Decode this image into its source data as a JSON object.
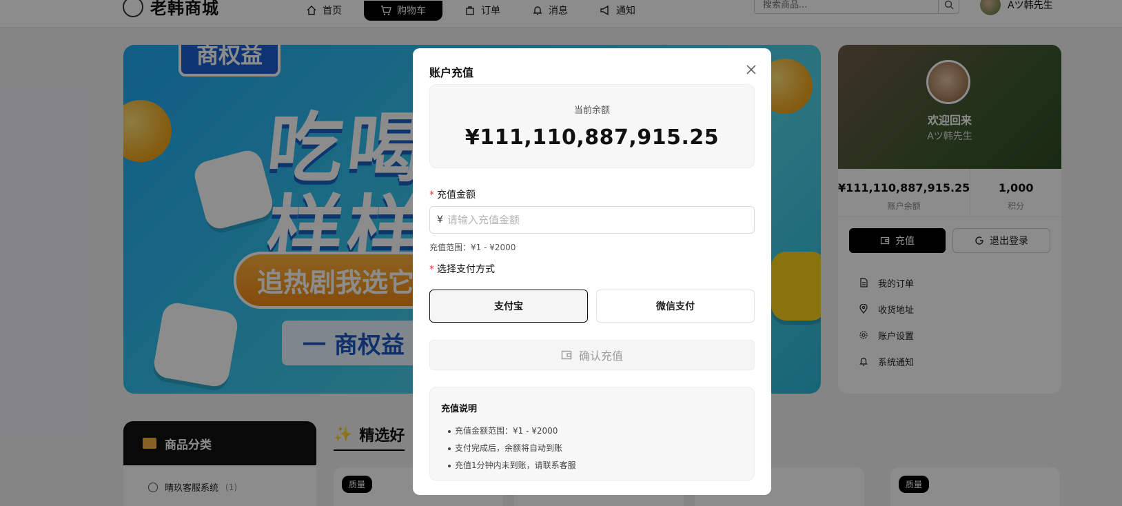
{
  "header": {
    "logo_text": "老韩商城",
    "nav": [
      {
        "label": "首页",
        "icon": "home-icon"
      },
      {
        "label": "购物车",
        "icon": "cart-icon"
      },
      {
        "label": "订单",
        "icon": "bag-icon"
      },
      {
        "label": "消息",
        "icon": "bell-icon"
      },
      {
        "label": "通知",
        "icon": "megaphone-icon"
      }
    ],
    "active_nav": "购物车",
    "search_placeholder": "搜索商品...",
    "username": "Aツ韩先生"
  },
  "banner": {
    "top_tag": "商权益",
    "line1": "吃喝",
    "line2": "样样",
    "pill": "追热剧我选它",
    "bar": "一 商权益"
  },
  "profile": {
    "welcome": "欢迎回来",
    "name": "Aツ韩先生",
    "balance_value": "¥111,110,887,915.25",
    "balance_label": "账户余额",
    "points_value": "1,000",
    "points_label": "积分",
    "recharge_btn": "充值",
    "logout_btn": "退出登录",
    "menu": [
      {
        "label": "我的订单",
        "icon": "document-icon"
      },
      {
        "label": "收货地址",
        "icon": "location-pin-icon"
      },
      {
        "label": "账户设置",
        "icon": "gear-icon"
      },
      {
        "label": "系统通知",
        "icon": "bell-icon"
      }
    ]
  },
  "categories": {
    "title": "商品分类",
    "items": [
      {
        "label": "晴玖客服系统",
        "count": "(1)"
      }
    ]
  },
  "featured": {
    "title": "精选好",
    "badge": "质量"
  },
  "modal": {
    "title": "账户充值",
    "balance_label": "当前余额",
    "balance_value": "¥111,110,887,915.25",
    "amount_label": "充值金额",
    "currency_symbol": "¥",
    "amount_placeholder": "请输入充值金额",
    "amount_value": "",
    "range_text": "充值范围：¥1 - ¥2000",
    "payment_label": "选择支付方式",
    "payment_options": [
      "支付宝",
      "微信支付"
    ],
    "selected_payment": "支付宝",
    "confirm_label": "确认充值",
    "notes_title": "充值说明",
    "notes": [
      "充值金额范围：¥1 - ¥2000",
      "支付完成后，余额将自动到账",
      "充值1分钟内未到账，请联系客服"
    ]
  }
}
